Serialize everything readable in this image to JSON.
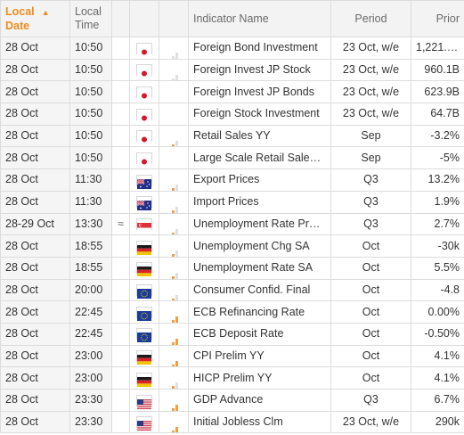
{
  "header": {
    "local_date": "Local\nDate",
    "local_date_l1": "Local",
    "local_date_l2": "Date",
    "local_time_l1": "Local",
    "local_time_l2": "Time",
    "indicator": "Indicator Name",
    "period": "Period",
    "prior": "Prior",
    "sort_arrow": "▲"
  },
  "colors": {
    "accent": "#f08c1e",
    "importance_on": "#f0a040"
  },
  "rows": [
    {
      "date": "28 Oct",
      "time": "10:50",
      "mark": "",
      "flag": "japan-flag-icon",
      "importance": 1,
      "indicator": "Foreign Bond Investment",
      "period": "23 Oct, w/e",
      "prior": "1,221.3B"
    },
    {
      "date": "28 Oct",
      "time": "10:50",
      "mark": "",
      "flag": "japan-flag-icon",
      "importance": 1,
      "indicator": "Foreign Invest JP Stock",
      "period": "23 Oct, w/e",
      "prior": "960.1B"
    },
    {
      "date": "28 Oct",
      "time": "10:50",
      "mark": "",
      "flag": "japan-flag-icon",
      "importance": 0,
      "indicator": "Foreign Invest JP Bonds",
      "period": "23 Oct, w/e",
      "prior": "623.9B"
    },
    {
      "date": "28 Oct",
      "time": "10:50",
      "mark": "",
      "flag": "japan-flag-icon",
      "importance": 0,
      "indicator": "Foreign Stock Investment",
      "period": "23 Oct, w/e",
      "prior": "64.7B"
    },
    {
      "date": "28 Oct",
      "time": "10:50",
      "mark": "",
      "flag": "japan-flag-icon",
      "importance": 2,
      "indicator": "Retail Sales YY",
      "period": "Sep",
      "prior": "-3.2%"
    },
    {
      "date": "28 Oct",
      "time": "10:50",
      "mark": "",
      "flag": "japan-flag-icon",
      "importance": 0,
      "indicator": "Large Scale Retail Sales ...",
      "period": "Sep",
      "prior": "-5%"
    },
    {
      "date": "28 Oct",
      "time": "11:30",
      "mark": "",
      "flag": "australia-flag-icon",
      "importance": 2,
      "indicator": "Export Prices",
      "period": "Q3",
      "prior": "13.2%"
    },
    {
      "date": "28 Oct",
      "time": "11:30",
      "mark": "",
      "flag": "australia-flag-icon",
      "importance": 2,
      "indicator": "Import Prices",
      "period": "Q3",
      "prior": "1.9%"
    },
    {
      "date": "28-29 Oct",
      "time": "13:30",
      "mark": "≈",
      "flag": "singapore-flag-icon",
      "importance": 2,
      "indicator": "Unemployment Rate Prel...",
      "period": "Q3",
      "prior": "2.7%"
    },
    {
      "date": "28 Oct",
      "time": "18:55",
      "mark": "",
      "flag": "germany-flag-icon",
      "importance": 2,
      "indicator": "Unemployment Chg SA",
      "period": "Oct",
      "prior": "-30k"
    },
    {
      "date": "28 Oct",
      "time": "18:55",
      "mark": "",
      "flag": "germany-flag-icon",
      "importance": 2,
      "indicator": "Unemployment Rate SA",
      "period": "Oct",
      "prior": "5.5%"
    },
    {
      "date": "28 Oct",
      "time": "20:00",
      "mark": "",
      "flag": "eu-flag-icon",
      "importance": 2,
      "indicator": "Consumer Confid. Final",
      "period": "Oct",
      "prior": "-4.8"
    },
    {
      "date": "28 Oct",
      "time": "22:45",
      "mark": "",
      "flag": "eu-flag-icon",
      "importance": 3,
      "indicator": "ECB Refinancing Rate",
      "period": "Oct",
      "prior": "0.00%"
    },
    {
      "date": "28 Oct",
      "time": "22:45",
      "mark": "",
      "flag": "eu-flag-icon",
      "importance": 3,
      "indicator": "ECB Deposit Rate",
      "period": "Oct",
      "prior": "-0.50%"
    },
    {
      "date": "28 Oct",
      "time": "23:00",
      "mark": "",
      "flag": "germany-flag-icon",
      "importance": 3,
      "indicator": "CPI Prelim YY",
      "period": "Oct",
      "prior": "4.1%"
    },
    {
      "date": "28 Oct",
      "time": "23:00",
      "mark": "",
      "flag": "germany-flag-icon",
      "importance": 2,
      "indicator": "HICP Prelim YY",
      "period": "Oct",
      "prior": "4.1%"
    },
    {
      "date": "28 Oct",
      "time": "23:30",
      "mark": "",
      "flag": "us-flag-icon",
      "importance": 3,
      "indicator": "GDP Advance",
      "period": "Q3",
      "prior": "6.7%"
    },
    {
      "date": "28 Oct",
      "time": "23:30",
      "mark": "",
      "flag": "us-flag-icon",
      "importance": 3,
      "indicator": "Initial Jobless Clm",
      "period": "23 Oct, w/e",
      "prior": "290k"
    }
  ]
}
